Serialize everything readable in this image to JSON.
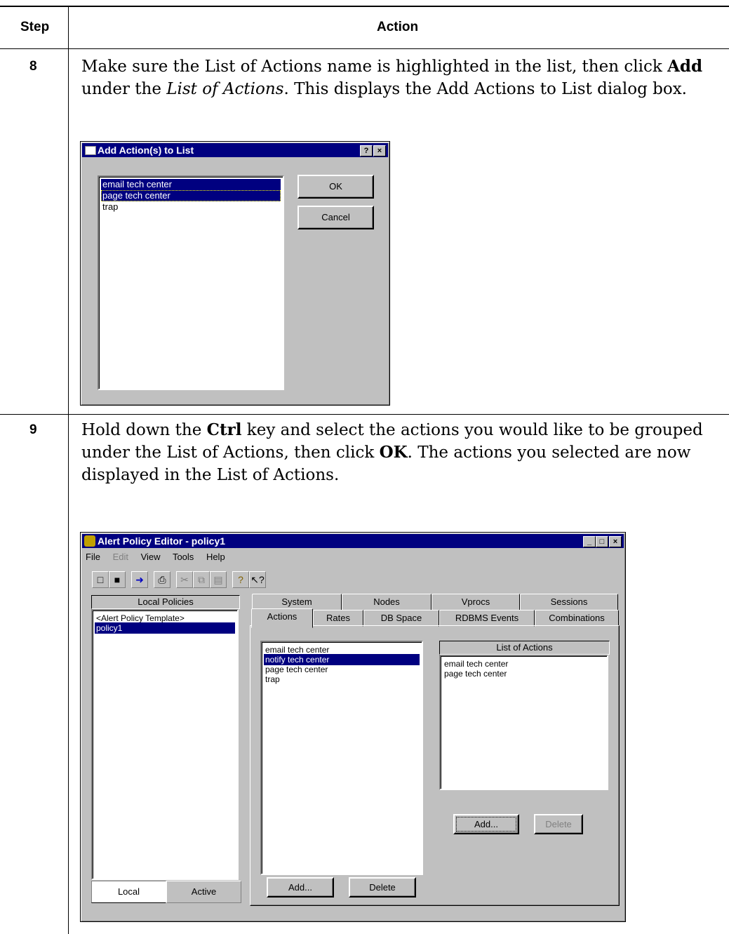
{
  "table": {
    "col_step": "Step",
    "col_action": "Action"
  },
  "step8": {
    "number": "8",
    "text_a": "Make sure the List of Actions name is highlighted in the list, then click ",
    "text_b": "Add",
    "text_c": " under the ",
    "text_d": "List of Actions",
    "text_e": ". This displays the Add Actions to List dialog box.",
    "dialog": {
      "title": "Add Action(s) to List",
      "help_btn": "?",
      "close_btn": "×",
      "items": [
        "email tech center",
        "page tech center",
        "trap"
      ],
      "ok": "OK",
      "cancel": "Cancel"
    }
  },
  "step9": {
    "number": "9",
    "text_a": "Hold down the ",
    "text_b": "Ctrl",
    "text_c": " key and select the actions you would like to be grouped under the List of Actions, then click ",
    "text_d": "OK",
    "text_e": ". The actions you selected are now displayed in the List of Actions.",
    "editor": {
      "title": "Alert Policy Editor - policy1",
      "menu": [
        "File",
        "Edit",
        "View",
        "Tools",
        "Help"
      ],
      "local_policies_header": "Local Policies",
      "policies": [
        "<Alert Policy Template>",
        "policy1"
      ],
      "tabs_back": [
        "System",
        "Nodes",
        "Vprocs",
        "Sessions"
      ],
      "tabs_front": [
        "Actions",
        "Rates",
        "DB Space",
        "RDBMS Events",
        "Combinations"
      ],
      "actions": [
        "email tech center",
        "notify tech center",
        "page tech center",
        "trap"
      ],
      "list_of_actions_header": "List of Actions",
      "list_of_actions": [
        "email tech center",
        "page tech center"
      ],
      "add_btn_right": "Add...",
      "delete_btn_right": "Delete",
      "add_btn": "Add...",
      "delete_btn": "Delete",
      "local_tab": "Local",
      "active_tab": "Active"
    }
  }
}
